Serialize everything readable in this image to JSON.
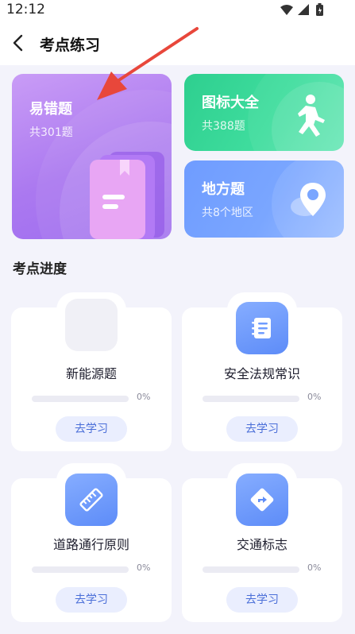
{
  "status_bar": {
    "time": "12:12"
  },
  "header": {
    "title": "考点练习"
  },
  "cards": {
    "error_questions": {
      "title": "易错题",
      "subtitle": "共301题"
    },
    "icons": {
      "title": "图标大全",
      "subtitle": "共388题"
    },
    "local": {
      "title": "地方题",
      "subtitle": "共8个地区"
    }
  },
  "section": {
    "title": "考点进度"
  },
  "topics": [
    {
      "name": "新能源题",
      "progress_label": "0%",
      "progress": 0,
      "button": "去学习",
      "icon": "car-icon"
    },
    {
      "name": "安全法规常识",
      "progress_label": "0%",
      "progress": 0,
      "button": "去学习",
      "icon": "notebook-icon"
    },
    {
      "name": "道路通行原则",
      "progress_label": "0%",
      "progress": 0,
      "button": "去学习",
      "icon": "ruler-icon"
    },
    {
      "name": "交通标志",
      "progress_label": "0%",
      "progress": 0,
      "button": "去学习",
      "icon": "turn-sign-icon"
    }
  ],
  "colors": {
    "accent_purple": "#ab79f0",
    "accent_green": "#3fdd9e",
    "accent_blue": "#7aa6ff",
    "arrow_red": "#e8473b"
  }
}
